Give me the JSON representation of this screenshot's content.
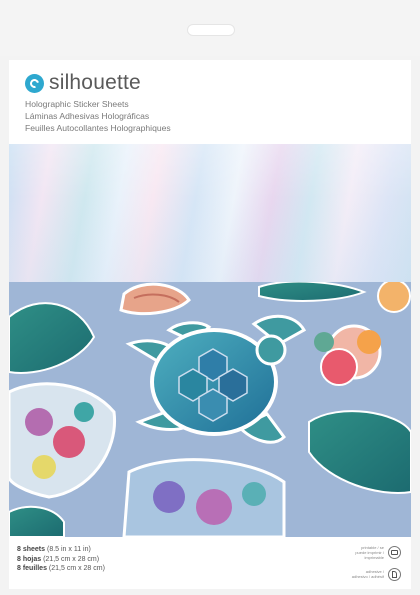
{
  "brand": {
    "name": "silhouette",
    "logo_icon": "silhouette-swirl-logo",
    "color": "#2ea8cf"
  },
  "product_titles": [
    "Holographic Sticker Sheets",
    "Láminas Adhesivas Holográficas",
    "Feuilles Autocollantes Holographiques"
  ],
  "specs": [
    {
      "count": "8 sheets",
      "size": "(8.5 in x 11 in)"
    },
    {
      "count": "8 hojas",
      "size": "(21,5 cm x 28 cm)"
    },
    {
      "count": "8 feuilles",
      "size": "(21,5 cm x 28 cm)"
    }
  ],
  "badges": [
    {
      "icon": "printer-icon",
      "text": "printable / se puede imprimir / imprimable"
    },
    {
      "icon": "adhesive-peel-icon",
      "text": "adhesive / adhesivo / adhésif"
    }
  ],
  "images": {
    "holographic_sample": "holographic-swatch",
    "photo": "sea-turtle-and-tropical-flower-stickers"
  }
}
